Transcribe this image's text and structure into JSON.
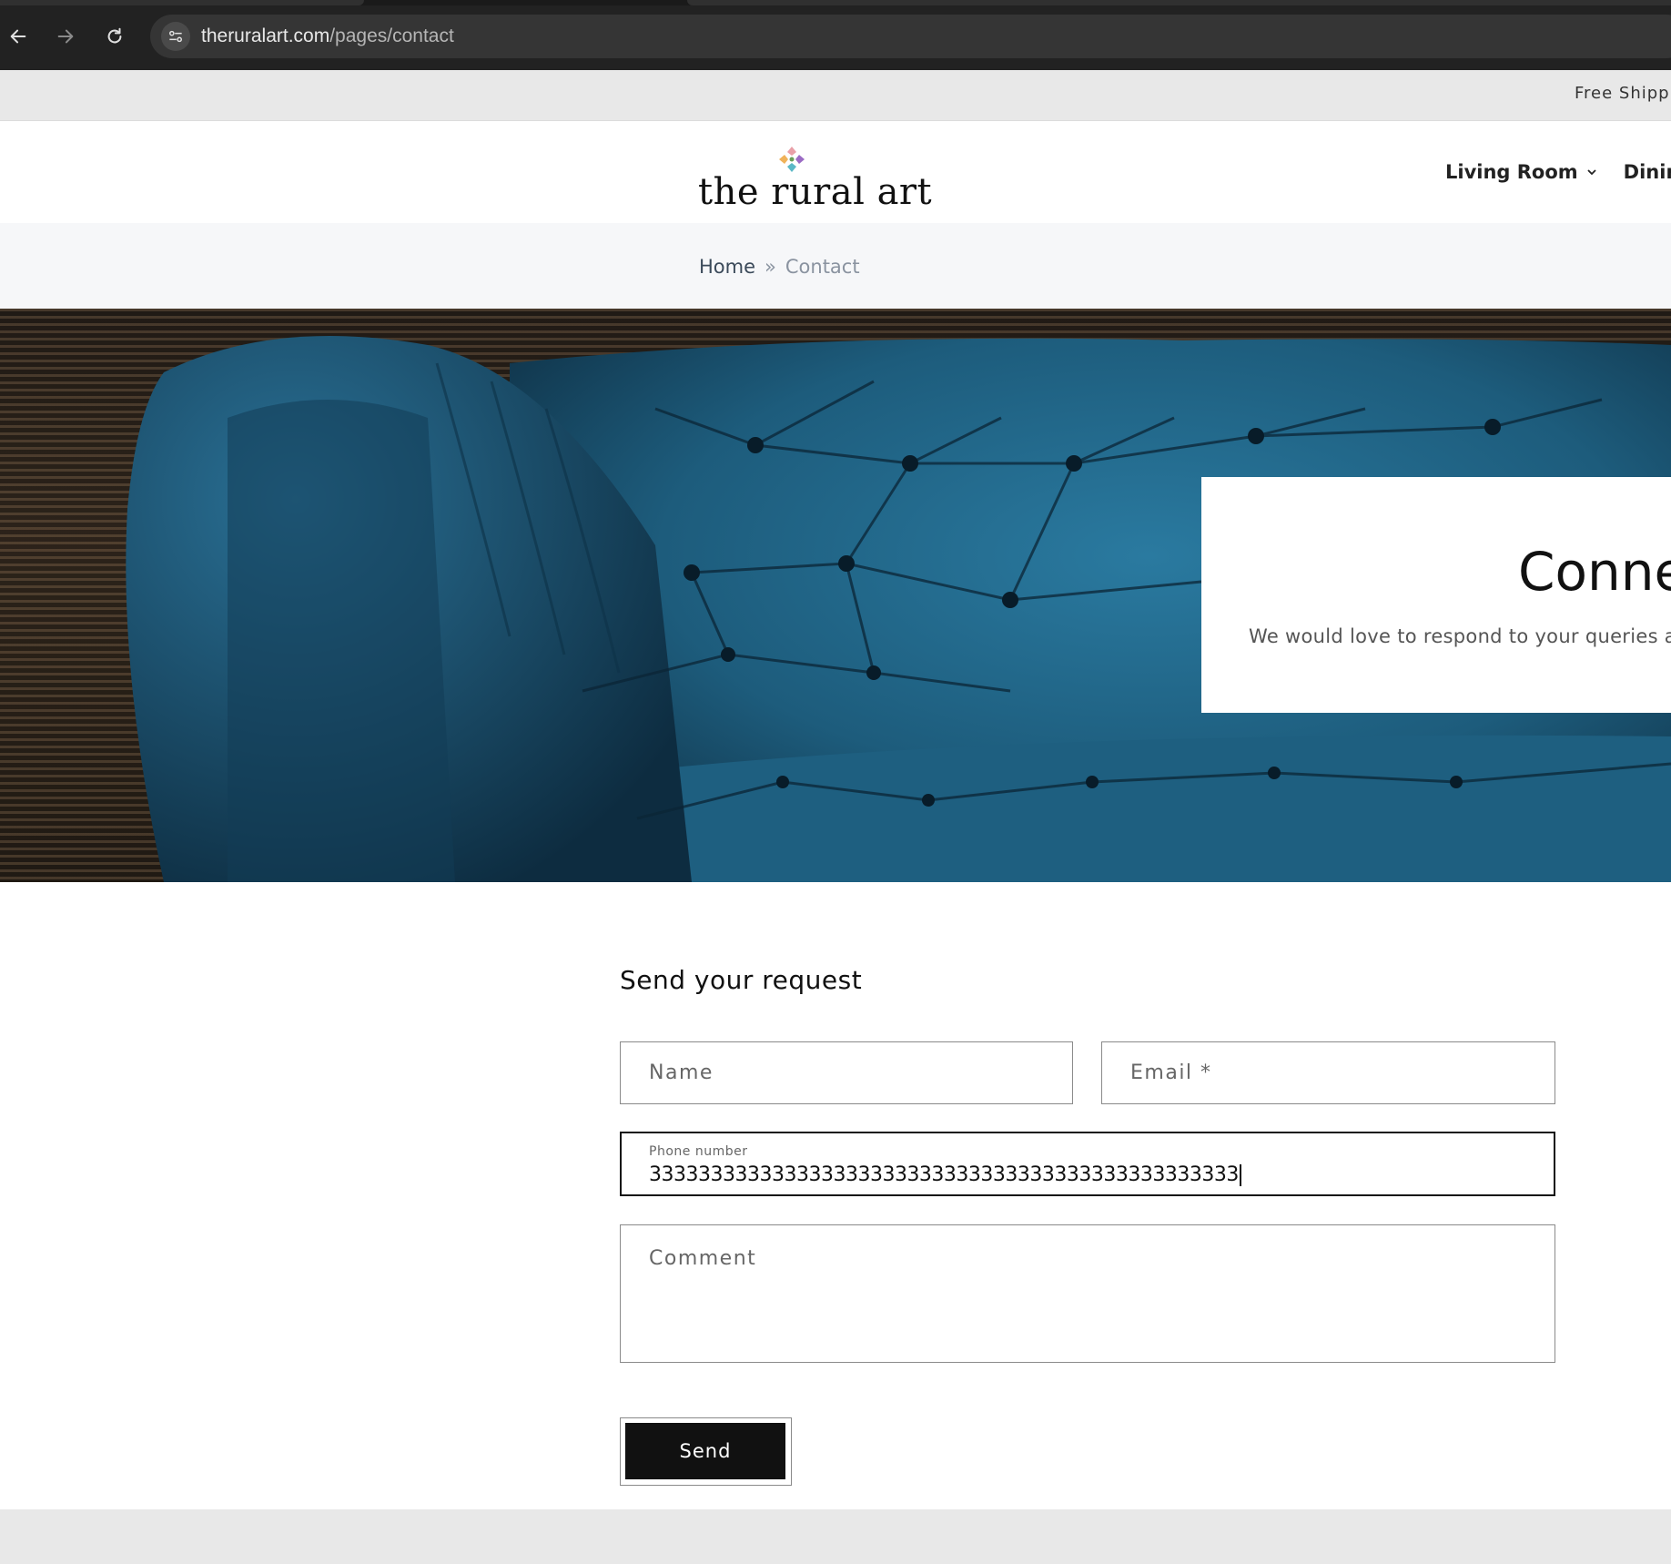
{
  "browser": {
    "url_domain": "theruralart.com",
    "url_path": "/pages/contact",
    "icons": [
      "back-arrow-icon",
      "forward-arrow-icon",
      "reload-icon",
      "site-settings-icon"
    ]
  },
  "announcement": {
    "text": "Free Shippi"
  },
  "header": {
    "logo_text": "the rural art",
    "nav": [
      {
        "label": "Living Room"
      },
      {
        "label": "Dining"
      }
    ]
  },
  "breadcrumb": {
    "home": "Home",
    "separator": "»",
    "current": "Contact"
  },
  "hero": {
    "title": "Conne",
    "subtitle": "We would love to respond to your queries a"
  },
  "form": {
    "title": "Send your request",
    "name_placeholder": "Name",
    "email_placeholder": "Email *",
    "phone_label": "Phone number",
    "phone_value": "333333333333333333333333333333333333333333333333",
    "comment_placeholder": "Comment",
    "send_label": "Send"
  },
  "colors": {
    "chrome_bg": "#222222",
    "announcement_bg": "#e8e8e8",
    "button_bg": "#111111",
    "sofa_blue": "#1f5f7e"
  }
}
